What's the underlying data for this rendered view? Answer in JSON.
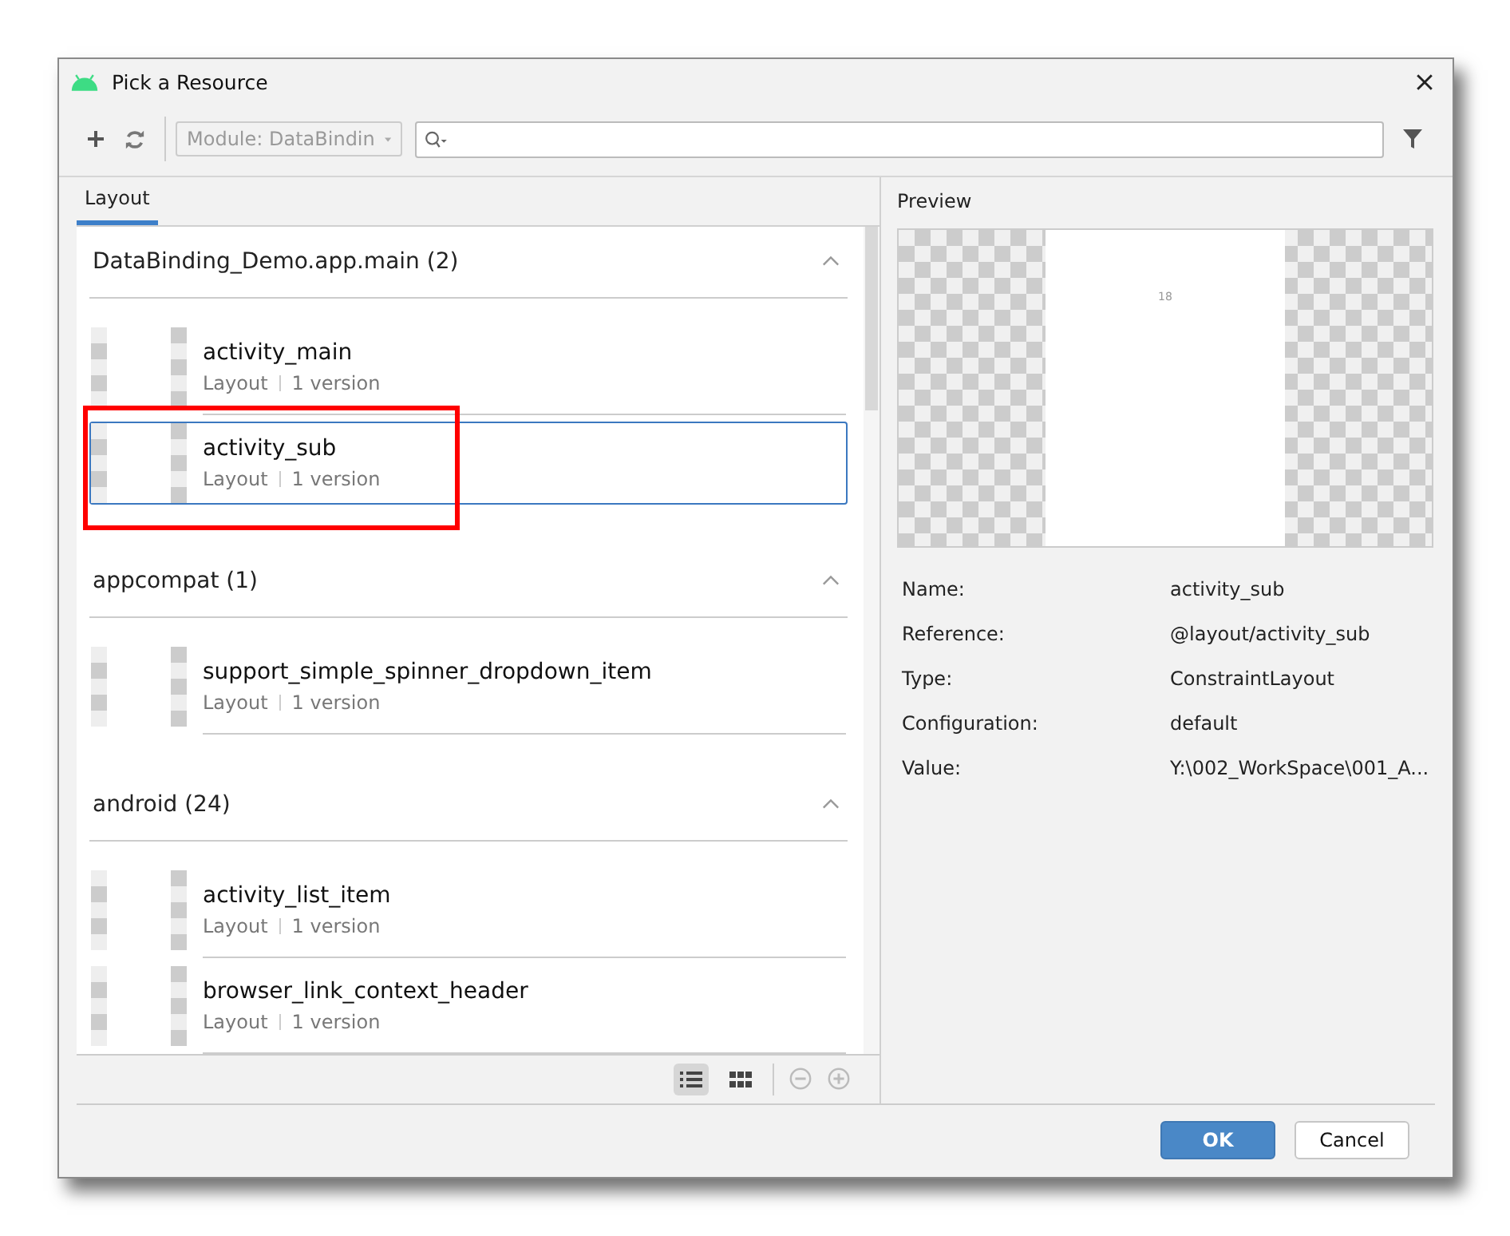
{
  "window": {
    "title": "Pick a Resource"
  },
  "toolbar": {
    "module": "Module: DataBindin"
  },
  "tabs": [
    {
      "label": "Layout",
      "selected": true
    }
  ],
  "groups": [
    {
      "title": "DataBinding_Demo.app.main (2)",
      "expanded": true,
      "items": [
        {
          "name": "activity_main",
          "type": "Layout",
          "versions": "1 version",
          "selected": false,
          "highlighted": false
        },
        {
          "name": "activity_sub",
          "type": "Layout",
          "versions": "1 version",
          "selected": true,
          "highlighted": true
        }
      ]
    },
    {
      "title": "appcompat (1)",
      "expanded": true,
      "items": [
        {
          "name": "support_simple_spinner_dropdown_item",
          "type": "Layout",
          "versions": "1 version",
          "selected": false,
          "highlighted": false
        }
      ]
    },
    {
      "title": "android (24)",
      "expanded": true,
      "items": [
        {
          "name": "activity_list_item",
          "type": "Layout",
          "versions": "1 version",
          "selected": false,
          "highlighted": false
        },
        {
          "name": "browser_link_context_header",
          "type": "Layout",
          "versions": "1 version",
          "selected": false,
          "highlighted": false
        }
      ]
    }
  ],
  "view_modes": [
    {
      "kind": "list",
      "selected": true
    },
    {
      "kind": "grid",
      "selected": false
    }
  ],
  "preview": {
    "title": "Preview",
    "text": "18"
  },
  "details": [
    {
      "label": "Name:",
      "value": "activity_sub"
    },
    {
      "label": "Reference:",
      "value": "@layout/activity_sub"
    },
    {
      "label": "Type:",
      "value": "ConstraintLayout"
    },
    {
      "label": "Configuration:",
      "value": "default"
    },
    {
      "label": "Value:",
      "value": "Y:\\002_WorkSpace\\001_A..."
    }
  ],
  "buttons": [
    {
      "label": "OK",
      "kind": "primary"
    },
    {
      "label": "Cancel",
      "kind": "secondary"
    }
  ]
}
